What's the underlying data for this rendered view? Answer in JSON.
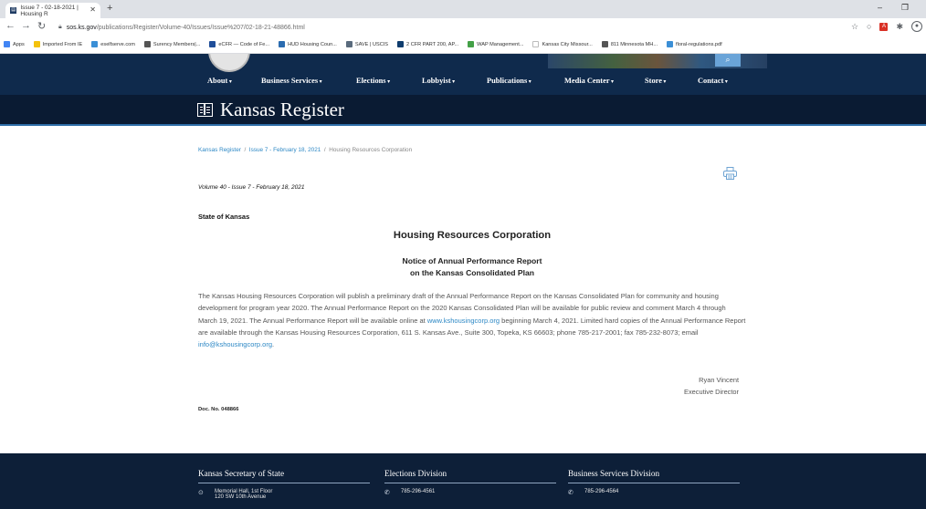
{
  "browser": {
    "tab_title": "Issue 7 - 02-18-2021 | Housing R",
    "new_tab_label": "+",
    "url_domain": "sos.ks.gov",
    "url_path": "/publications/Register/Volume-40/Issues/Issue%207/02-18-21-48866.html",
    "bookmarks": [
      {
        "label": "Apps",
        "icon": "apps-grid-icon",
        "color": "#4285f4"
      },
      {
        "label": "Imported From IE",
        "icon": "folder-icon",
        "color": "#f4c20d"
      },
      {
        "label": "eselfserve.com",
        "icon": "site-icon",
        "color": "#3b8fd6"
      },
      {
        "label": "Surency Members|...",
        "icon": "globe-icon",
        "color": "#555555"
      },
      {
        "label": "eCFR — Code of Fe...",
        "icon": "ecfr-icon",
        "color": "#1f4e99"
      },
      {
        "label": "HUD Housing Coun...",
        "icon": "hud-icon",
        "color": "#2b6cb0"
      },
      {
        "label": "SAVE | USCIS",
        "icon": "uscis-icon",
        "color": "#5a6b7d"
      },
      {
        "label": "2 CFR PART 200, AP...",
        "icon": "cfr-icon",
        "color": "#0f3d6e"
      },
      {
        "label": "WAP Management...",
        "icon": "wap-icon",
        "color": "#43a047"
      },
      {
        "label": "Kansas City Missour...",
        "icon": "kc-icon",
        "color": "#ffffff"
      },
      {
        "label": "811 Minnesota MH...",
        "icon": "globe-icon",
        "color": "#555555"
      },
      {
        "label": "floral-regulations.pdf",
        "icon": "pdf-globe-icon",
        "color": "#3b8fd6"
      }
    ]
  },
  "site": {
    "menu": [
      "About",
      "Business Services",
      "Elections",
      "Lobbyist",
      "Publications",
      "Media Center",
      "Store",
      "Contact"
    ],
    "title": "Kansas Register"
  },
  "breadcrumb": {
    "items": [
      "Kansas Register",
      "Issue 7 - February 18, 2021",
      "Housing Resources Corporation"
    ],
    "separator": "/"
  },
  "article": {
    "issue": "Volume 40 - Issue 7 - February 18, 2021",
    "state": "State of Kansas",
    "org_title": "Housing Resources Corporation",
    "notice_line1": "Notice of Annual Performance Report",
    "notice_line2": "on the Kansas Consolidated Plan",
    "body_part1": "The Kansas Housing Resources Corporation will publish a preliminary draft of the Annual Performance Report on the Kansas Consolidated Plan for community and housing development for program year 2020. The Annual Performance Report on the 2020 Kansas Consolidated Plan will be available for public review and comment March 4 through March 19, 2021. The Annual Performance Report will be available online at ",
    "link_website": "www.kshousingcorp.org",
    "body_part2": " beginning March 4, 2021. Limited hard copies of the Annual Performance Report are available through the Kansas Housing Resources Corporation, 611 S. Kansas Ave., Suite 300, Topeka, KS 66603; phone 785-217-2001; fax 785-232-8073; email ",
    "link_email": "info@kshousingcorp.org",
    "body_part3": ".",
    "signer_name": "Ryan Vincent",
    "signer_title": "Executive Director",
    "doc_no": "Doc. No. 048866"
  },
  "footer": {
    "columns": [
      {
        "heading": "Kansas Secretary of State",
        "line1": "Memorial Hall, 1st Floor",
        "line2": "120 SW 10th Avenue",
        "icon": "map-pin-icon"
      },
      {
        "heading": "Elections Division",
        "line1": "785-296-4561",
        "line2": "",
        "icon": "phone-icon"
      },
      {
        "heading": "Business Services Division",
        "line1": "785-296-4564",
        "line2": "",
        "icon": "phone-icon"
      }
    ]
  }
}
